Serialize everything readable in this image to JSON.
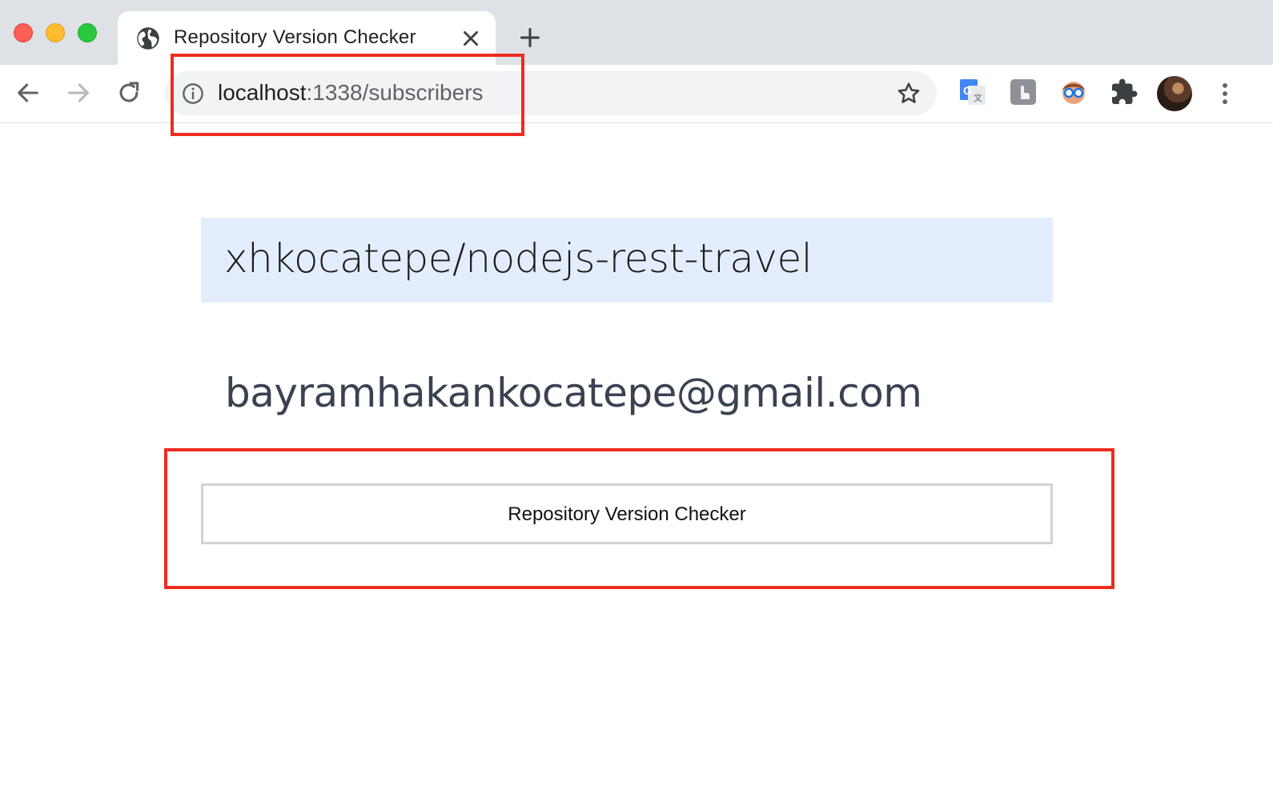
{
  "browser": {
    "tab": {
      "title": "Repository Version Checker",
      "icon": "globe-icon"
    },
    "address_bar": {
      "host": "localhost",
      "path": ":1338/subscribers"
    },
    "extensions": [
      "google-translate-icon",
      "hand-pointer-extension-icon",
      "glasses-face-extension-icon",
      "puzzle-extensions-icon"
    ]
  },
  "page": {
    "repository": "xhkocatepe/nodejs-rest-travel",
    "email": "bayramhakankocatepe@gmail.com",
    "button_label": "Repository Version Checker"
  },
  "colors": {
    "highlight": "#ef2b1f",
    "banner_bg": "#e4edfd"
  }
}
